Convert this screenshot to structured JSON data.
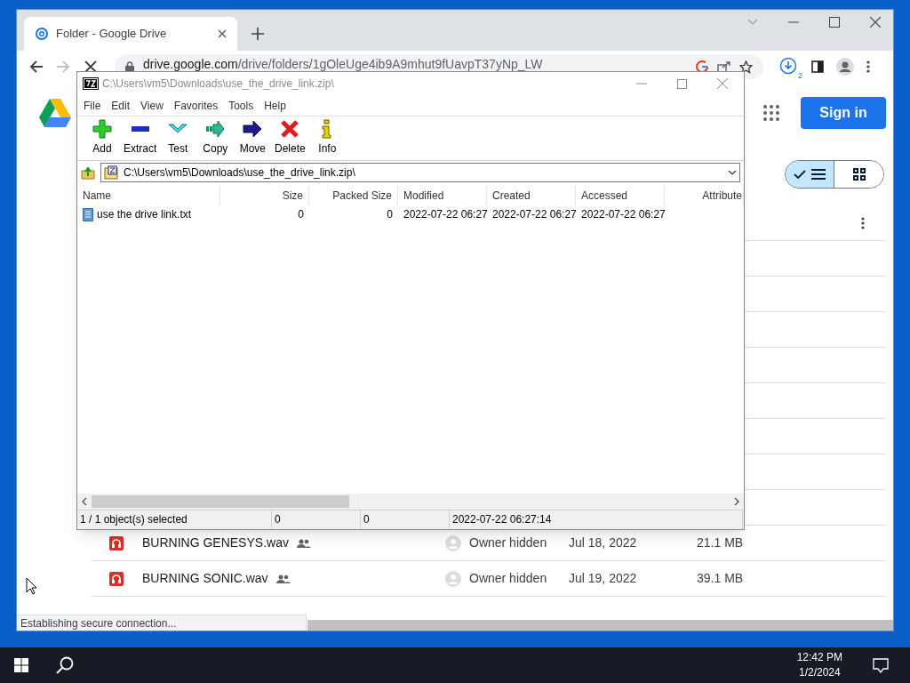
{
  "browser": {
    "tab": {
      "title": "Folder - Google Drive",
      "selected": true
    },
    "url": {
      "host": "drive.google.com",
      "path": "/drive/folders/1gOleUge4ib9A9mhut9fUavpT37yNp_LW"
    },
    "downloads_count": "2",
    "status_text": "Establishing secure connection..."
  },
  "drive": {
    "sign_in": "Sign in",
    "view": [
      {
        "kind": "list",
        "selected": true
      },
      {
        "kind": "grid",
        "selected": false
      }
    ],
    "files": [
      {
        "name": "BURNING GENESYS.wav",
        "shared": true,
        "owner": "Owner hidden",
        "modified": "Jul 18, 2022",
        "size": "21.1 MB"
      },
      {
        "name": "BURNING SONIC.wav",
        "shared": true,
        "owner": "Owner hidden",
        "modified": "Jul 19, 2022",
        "size": "39.1 MB"
      }
    ]
  },
  "archiver": {
    "title": "C:\\Users\\vm5\\Downloads\\use_the_drive_link.zip\\",
    "menu": [
      "File",
      "Edit",
      "View",
      "Favorites",
      "Tools",
      "Help"
    ],
    "toolbar": [
      {
        "kind": "add",
        "label": "Add"
      },
      {
        "kind": "extract",
        "label": "Extract"
      },
      {
        "kind": "test",
        "label": "Test"
      },
      {
        "kind": "copy",
        "label": "Copy"
      },
      {
        "kind": "move",
        "label": "Move"
      },
      {
        "kind": "delete",
        "label": "Delete"
      },
      {
        "kind": "info",
        "label": "Info"
      }
    ],
    "path": "C:\\Users\\vm5\\Downloads\\use_the_drive_link.zip\\",
    "columns": [
      "Name",
      "Size",
      "Packed Size",
      "Modified",
      "Created",
      "Accessed",
      "Attribute"
    ],
    "rows": [
      {
        "cells": [
          "use the drive link.txt",
          "0",
          "0",
          "2022-07-22 06:27",
          "2022-07-22 06:27",
          "2022-07-22 06:27"
        ]
      }
    ],
    "status": [
      "1 / 1 object(s) selected",
      "0",
      "0",
      "2022-07-22 06:27:14"
    ]
  },
  "taskbar": {
    "time": "12:42 PM",
    "date": "1/2/2024"
  }
}
